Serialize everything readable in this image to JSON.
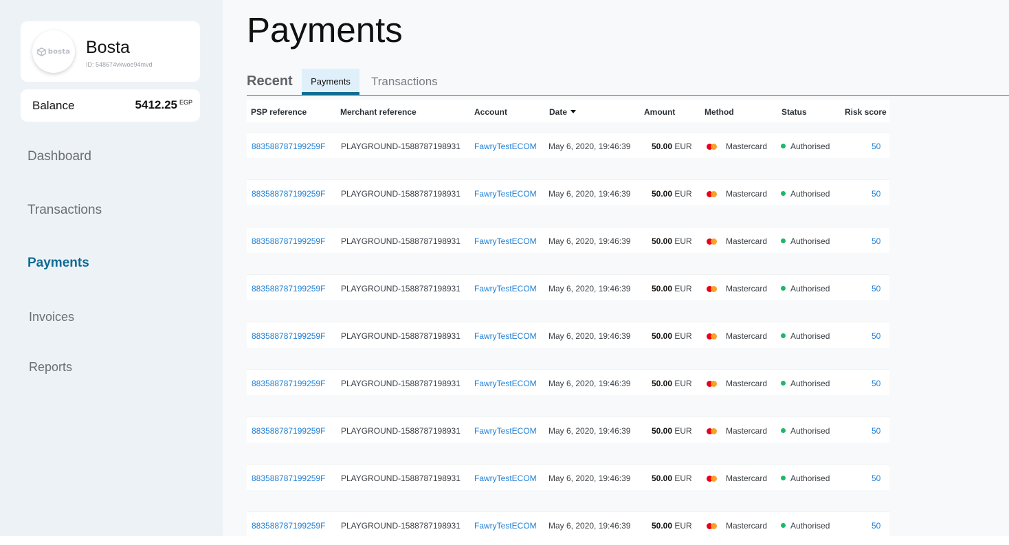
{
  "account": {
    "logo_text": "bosta",
    "name": "Bosta",
    "id_text": "ID: 548674vkwoe94mvd"
  },
  "balance": {
    "label": "Balance",
    "value": "5412.25",
    "currency": "EGP"
  },
  "nav": [
    {
      "label": "Dashboard",
      "active": false
    },
    {
      "label": "Transactions",
      "active": false
    },
    {
      "label": "Payments",
      "active": true
    },
    {
      "label": "Invoices",
      "active": false
    },
    {
      "label": "Reports",
      "active": false
    }
  ],
  "page": {
    "title": "Payments"
  },
  "tabs": {
    "heading": "Recent",
    "items": [
      {
        "label": "Payments",
        "active": true
      },
      {
        "label": "Transactions",
        "active": false
      }
    ]
  },
  "table": {
    "columns": [
      "PSP reference",
      "Merchant reference",
      "Account",
      "Date",
      "Amount",
      "Method",
      "Status",
      "Risk score"
    ],
    "sorted_column": "Date",
    "rows": [
      {
        "psp": "883588787199259F",
        "merchant": "PLAYGROUND-1588787198931",
        "account": "FawryTestECOM",
        "date": "May 6, 2020, 19:46:39",
        "amount": "50.00",
        "currency": "EUR",
        "method": "Mastercard",
        "status": "Authorised",
        "risk": "50"
      },
      {
        "psp": "883588787199259F",
        "merchant": "PLAYGROUND-1588787198931",
        "account": "FawryTestECOM",
        "date": "May 6, 2020, 19:46:39",
        "amount": "50.00",
        "currency": "EUR",
        "method": "Mastercard",
        "status": "Authorised",
        "risk": "50"
      },
      {
        "psp": "883588787199259F",
        "merchant": "PLAYGROUND-1588787198931",
        "account": "FawryTestECOM",
        "date": "May 6, 2020, 19:46:39",
        "amount": "50.00",
        "currency": "EUR",
        "method": "Mastercard",
        "status": "Authorised",
        "risk": "50"
      },
      {
        "psp": "883588787199259F",
        "merchant": "PLAYGROUND-1588787198931",
        "account": "FawryTestECOM",
        "date": "May 6, 2020, 19:46:39",
        "amount": "50.00",
        "currency": "EUR",
        "method": "Mastercard",
        "status": "Authorised",
        "risk": "50"
      },
      {
        "psp": "883588787199259F",
        "merchant": "PLAYGROUND-1588787198931",
        "account": "FawryTestECOM",
        "date": "May 6, 2020, 19:46:39",
        "amount": "50.00",
        "currency": "EUR",
        "method": "Mastercard",
        "status": "Authorised",
        "risk": "50"
      },
      {
        "psp": "883588787199259F",
        "merchant": "PLAYGROUND-1588787198931",
        "account": "FawryTestECOM",
        "date": "May 6, 2020, 19:46:39",
        "amount": "50.00",
        "currency": "EUR",
        "method": "Mastercard",
        "status": "Authorised",
        "risk": "50"
      },
      {
        "psp": "883588787199259F",
        "merchant": "PLAYGROUND-1588787198931",
        "account": "FawryTestECOM",
        "date": "May 6, 2020, 19:46:39",
        "amount": "50.00",
        "currency": "EUR",
        "method": "Mastercard",
        "status": "Authorised",
        "risk": "50"
      },
      {
        "psp": "883588787199259F",
        "merchant": "PLAYGROUND-1588787198931",
        "account": "FawryTestECOM",
        "date": "May 6, 2020, 19:46:39",
        "amount": "50.00",
        "currency": "EUR",
        "method": "Mastercard",
        "status": "Authorised",
        "risk": "50"
      },
      {
        "psp": "883588787199259F",
        "merchant": "PLAYGROUND-1588787198931",
        "account": "FawryTestECOM",
        "date": "May 6, 2020, 19:46:39",
        "amount": "50.00",
        "currency": "EUR",
        "method": "Mastercard",
        "status": "Authorised",
        "risk": "50"
      }
    ]
  },
  "colors": {
    "accent": "#0e6b92",
    "link": "#1f7fd6",
    "status_authorised": "#1cb86a",
    "mastercard_red": "#eb001b",
    "mastercard_orange": "#f79e1b"
  },
  "icons": {
    "logo": "bosta-logo-icon",
    "sort": "sort-down-icon",
    "method": "mastercard-icon",
    "status": "status-dot-icon"
  }
}
